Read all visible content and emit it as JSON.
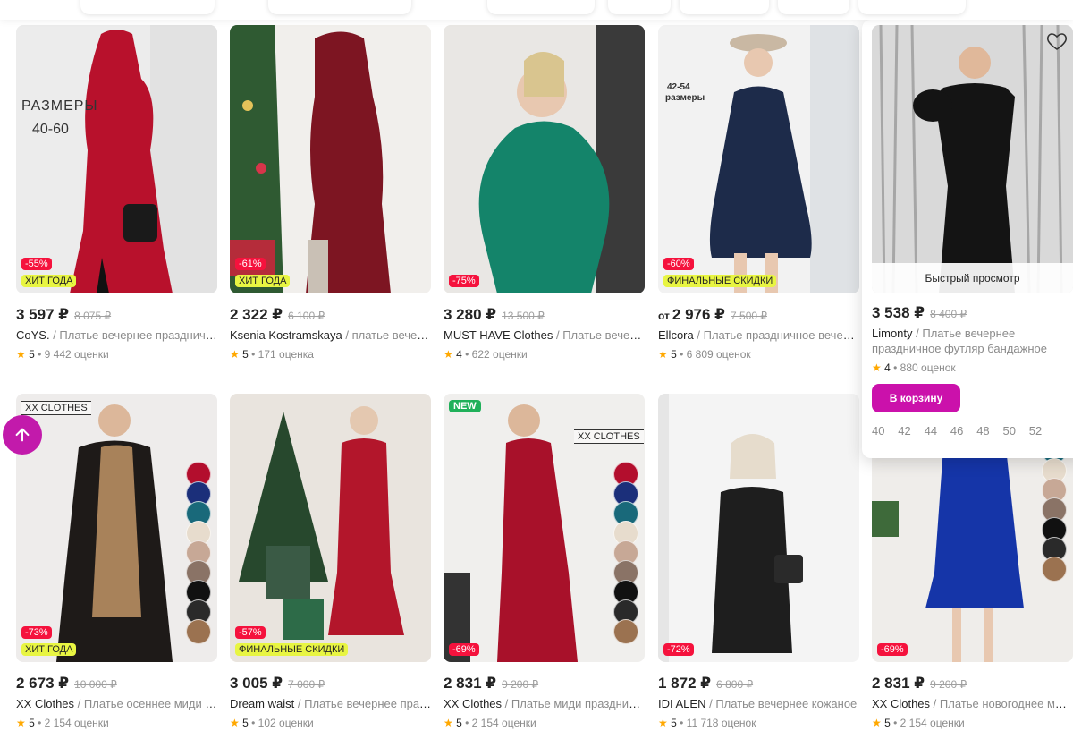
{
  "cards": [
    {
      "price": "3 597 ₽",
      "prefix": "",
      "old": "8 075 ₽",
      "brand": "CoYS.",
      "category": "/ Платье вечернее праздничн…",
      "rating": "5",
      "reviews": "9 442 оценки",
      "discount": "-55%",
      "label": "ХИТ ГОДА",
      "new": "",
      "logo": "",
      "imgtext": "РАЗМЕРЫ",
      "imgtext2": "40-60"
    },
    {
      "price": "2 322 ₽",
      "prefix": "",
      "old": "6 100 ₽",
      "brand": "Ksenia Kostramskaya",
      "category": "/ платье вечерн…",
      "rating": "5",
      "reviews": "171 оценка",
      "discount": "-61%",
      "label": "ХИТ ГОДА",
      "new": "",
      "logo": "",
      "imgtext": "",
      "imgtext2": ""
    },
    {
      "price": "3 280 ₽",
      "prefix": "",
      "old": "13 500 ₽",
      "brand": "MUST HAVE Clothes",
      "category": "/ Платье вечерн…",
      "rating": "4",
      "reviews": "622 оценки",
      "discount": "-75%",
      "label": "",
      "new": "",
      "logo": "",
      "imgtext": "",
      "imgtext2": ""
    },
    {
      "price": "2 976 ₽",
      "prefix": "от",
      "old": "7 500 ₽",
      "brand": "Ellcora",
      "category": "/ Платье праздничное вечерн…",
      "rating": "5",
      "reviews": "6 809 оценок",
      "discount": "-60%",
      "label": "ФИНАЛЬНЫЕ СКИДКИ",
      "new": "",
      "logo": "",
      "imgtext": "42-54",
      "imgtext2": "размеры"
    },
    {
      "price": "2 673 ₽",
      "prefix": "",
      "old": "10 000 ₽",
      "brand": "XX Clothes",
      "category": "/ Платье осеннее миди в …",
      "rating": "5",
      "reviews": "2 154 оценки",
      "discount": "-73%",
      "label": "ХИТ ГОДА",
      "new": "",
      "logo": "XX CLOTHES",
      "imgtext": "",
      "imgtext2": ""
    },
    {
      "price": "3 005 ₽",
      "prefix": "",
      "old": "7 000 ₽",
      "brand": "Dream waist",
      "category": "/ Платье вечернее праз…",
      "rating": "5",
      "reviews": "102 оценки",
      "discount": "-57%",
      "label": "ФИНАЛЬНЫЕ СКИДКИ",
      "new": "",
      "logo": "",
      "imgtext": "",
      "imgtext2": ""
    },
    {
      "price": "2 831 ₽",
      "prefix": "",
      "old": "9 200 ₽",
      "brand": "XX Clothes",
      "category": "/ Платье миди праздничн…",
      "rating": "5",
      "reviews": "2 154 оценки",
      "discount": "-69%",
      "label": "",
      "new": "NEW",
      "logo": "XX CLOTHES",
      "imgtext": "",
      "imgtext2": ""
    },
    {
      "price": "1 872 ₽",
      "prefix": "",
      "old": "6 800 ₽",
      "brand": "IDI ALEN",
      "category": "/ Платье вечернее кожаное",
      "rating": "5",
      "reviews": "11 718 оценок",
      "discount": "-72%",
      "label": "",
      "new": "",
      "logo": "",
      "imgtext": "",
      "imgtext2": ""
    },
    {
      "price": "2 831 ₽",
      "prefix": "",
      "old": "9 200 ₽",
      "brand": "XX Clothes",
      "category": "/ Платье новогоднее миди …",
      "rating": "5",
      "reviews": "2 154 оценки",
      "discount": "-69%",
      "label": "",
      "new": "",
      "logo": "",
      "imgtext": "",
      "imgtext2": ""
    }
  ],
  "hovered": {
    "price": "3 538 ₽",
    "old": "8 400 ₽",
    "brand": "Limonty",
    "category": "/ Платье вечернее праздничное футляр бандажное",
    "rating": "4",
    "reviews": "880 оценок",
    "quick_view": "Быстрый просмотр",
    "cart": "В корзину",
    "sizes": [
      "40",
      "42",
      "44",
      "46",
      "48",
      "50",
      "52"
    ]
  },
  "colors": {
    "accent": "#cb11ab",
    "discount": "#f5123d",
    "hit": "#e8f542",
    "star": "#ffa800"
  },
  "icons": {
    "scroll_up": "arrow-up-icon",
    "favorite": "heart-icon",
    "rating": "star-icon"
  }
}
